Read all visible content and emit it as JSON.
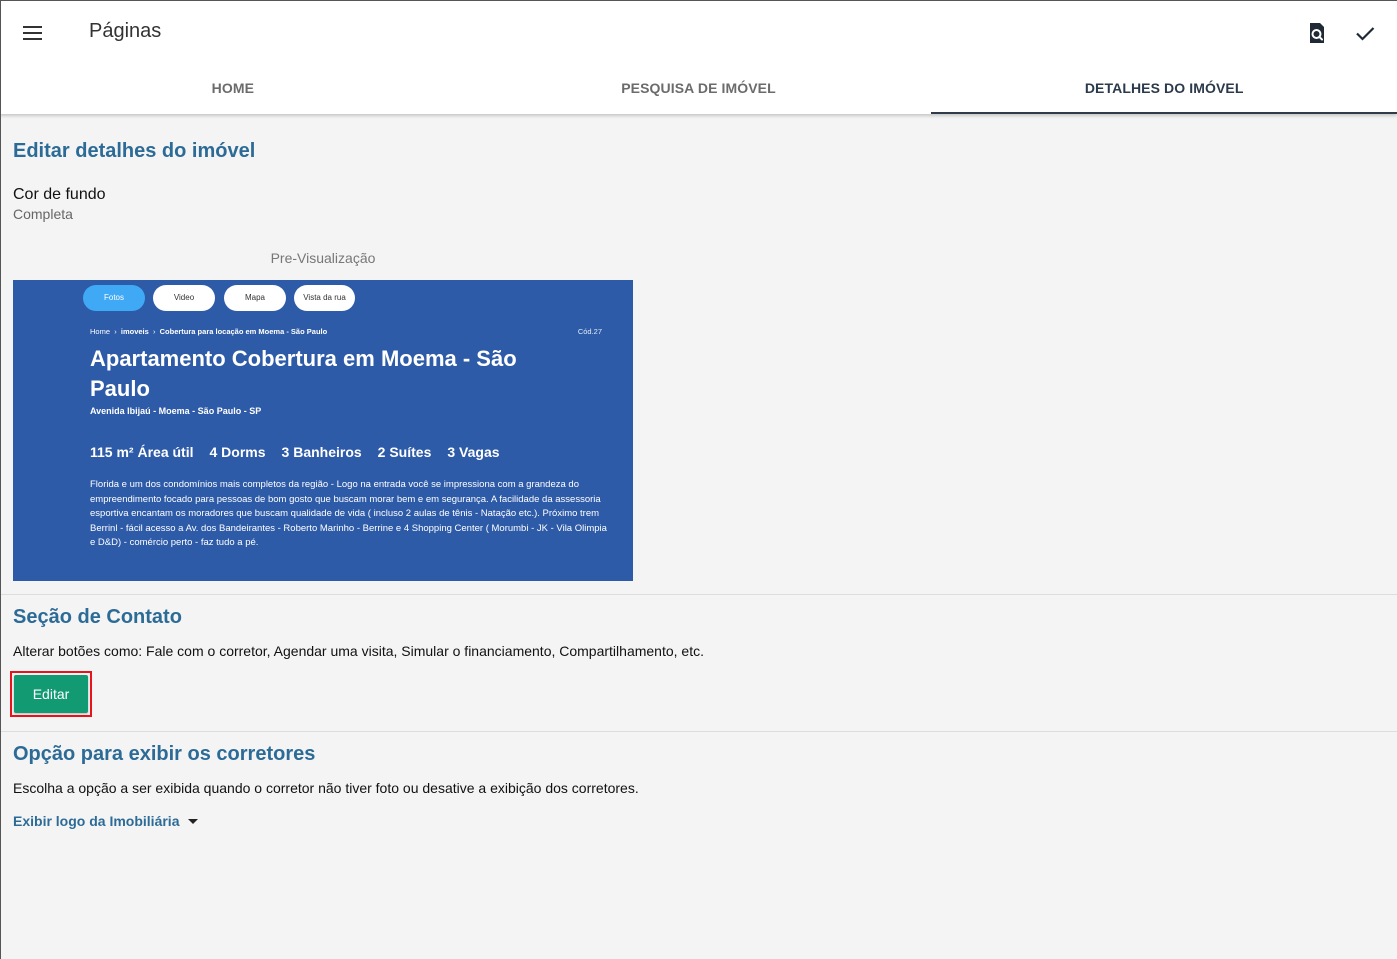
{
  "header": {
    "title": "Páginas",
    "tabs": [
      {
        "label": "HOME",
        "active": false
      },
      {
        "label": "PESQUISA DE IMÓVEL",
        "active": false
      },
      {
        "label": "DETALHES DO IMÓVEL",
        "active": true
      }
    ]
  },
  "details": {
    "title": "Editar detalhes do imóvel",
    "background_label": "Cor de fundo",
    "background_value": "Completa",
    "preview_caption": "Pre-Visualização"
  },
  "preview": {
    "buttons": [
      "Fotos",
      "Video",
      "Mapa",
      "Vista da rua"
    ],
    "breadcrumb": {
      "home": "Home",
      "sep": "›",
      "imoveis": "imoveis",
      "current": "Cobertura para locação em Moema - São Paulo"
    },
    "code": "Cód.27",
    "title": "Apartamento Cobertura em Moema - São Paulo",
    "address": "Avenida Ibijaú - Moema - São Paulo - SP",
    "features": [
      "115 m² Área útil",
      "4 Dorms",
      "3 Banheiros",
      "2 Suítes",
      "3 Vagas"
    ],
    "description": "Florida e um dos condomínios mais completos da região - Logo na entrada você se impressiona com a grandeza do empreendimento focado para pessoas de bom gosto que buscam morar bem e em segurança. A facilidade da assessoria esportiva encantam os moradores que buscam qualidade de vida ( incluso 2 aulas de tênis - Natação etc.). Próximo trem Berrinl - fácil acesso a Av. dos Bandeirantes - Roberto Marinho - Berrine e 4 Shopping Center ( Morumbi - JK - Vila Olimpia e D&D) - comércio perto - faz tudo a pé.",
    "background_color": "#2e5ba8",
    "active_button_color": "#3fa9f5"
  },
  "contact": {
    "title": "Seção de Contato",
    "description": "Alterar botões como: Fale com o corretor, Agendar uma visita, Simular o financiamento, Compartilhamento, etc.",
    "edit_label": "Editar"
  },
  "brokers": {
    "title": "Opção para exibir os corretores",
    "description": "Escolha a opção a ser exibida quando o corretor não tiver foto ou desative a exibição dos corretores.",
    "selected_option": "Exibir logo da Imobiliária"
  },
  "colors": {
    "accent_blue": "#2d6b97",
    "button_green": "#129a73",
    "highlight_red": "#e8141c"
  },
  "icons": {
    "menu": "menu-icon",
    "preview": "preview-search-icon",
    "save": "check-icon",
    "dropdown": "caret-down-icon"
  }
}
